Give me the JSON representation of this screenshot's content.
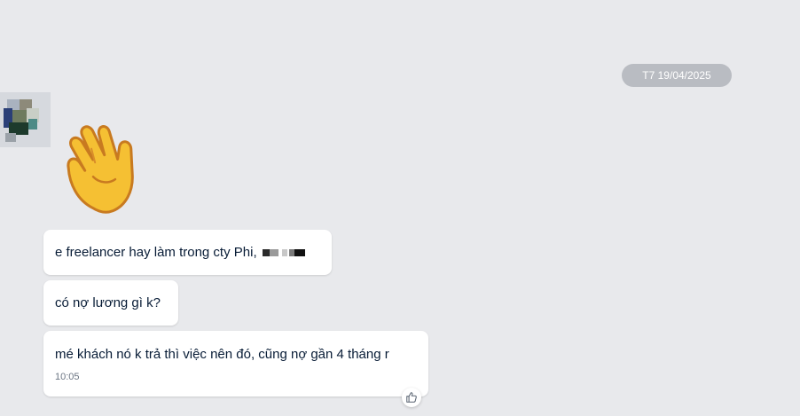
{
  "date_separator": "T7 19/04/2025",
  "sender": {
    "avatar_icon": "blurred-avatar"
  },
  "sticker": {
    "icon": "waving-hand-emoji"
  },
  "messages": [
    {
      "text": "e freelancer hay làm trong cty Phi,",
      "redacted_name": "redacted-name-icon"
    },
    {
      "text": "có nợ lương gì k?"
    },
    {
      "text": "mé khách nó k trả thì việc nên đó, cũng nợ gần 4 tháng r",
      "time": "10:05"
    }
  ],
  "reaction": {
    "icon": "thumbs-up-icon"
  },
  "colors": {
    "background": "#e8e9ec",
    "bubble": "#ffffff",
    "date_pill": "#b9bcc2",
    "text": "#081c36"
  }
}
